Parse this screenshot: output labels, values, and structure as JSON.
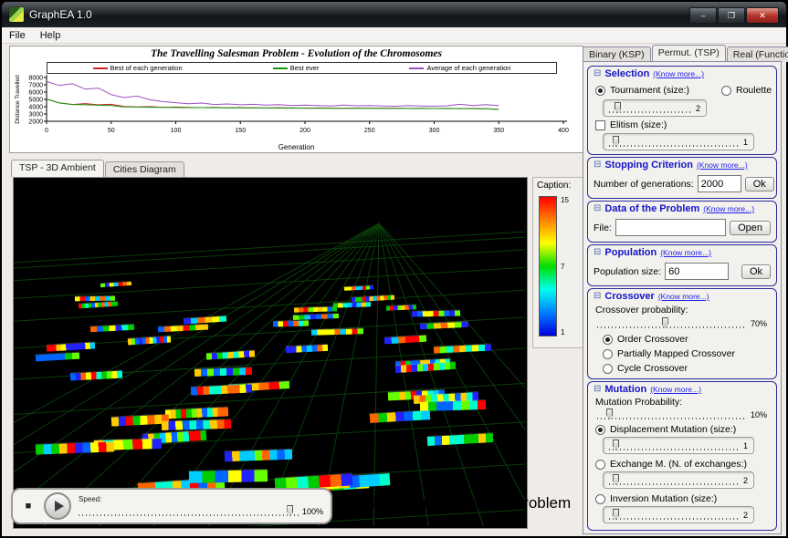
{
  "window": {
    "title": "GraphEA 1.0",
    "menus": [
      "File",
      "Help"
    ]
  },
  "icons": {
    "minimize": "–",
    "maximize": "❐",
    "close": "✕",
    "stop": "■",
    "collapse": "⊟"
  },
  "chart_data": {
    "type": "line",
    "title": "The Travelling Salesman Problem - Evolution of the Chromosomes",
    "xlabel": "Generation",
    "ylabel": "Distance Travelled",
    "xlim": [
      0,
      400
    ],
    "ylim": [
      2000,
      8000
    ],
    "xticks": [
      0,
      50,
      100,
      150,
      200,
      250,
      300,
      350,
      400
    ],
    "yticks": [
      2000,
      3000,
      4000,
      5000,
      6000,
      7000,
      8000
    ],
    "legend_position": "top",
    "grid": false,
    "x": [
      0,
      10,
      20,
      30,
      40,
      50,
      60,
      70,
      80,
      90,
      100,
      110,
      120,
      130,
      140,
      150,
      160,
      170,
      180,
      190,
      200,
      210,
      220,
      230,
      240,
      250,
      260,
      270,
      280,
      290,
      300,
      310,
      320,
      330,
      340,
      350
    ],
    "series": [
      {
        "name": "Best of each generation",
        "color": "#cc2222",
        "y": [
          5050,
          4520,
          4300,
          4420,
          4260,
          4330,
          4020,
          3960,
          4010,
          3900,
          3950,
          3900,
          3880,
          3910,
          3850,
          3880,
          3850,
          3830,
          3860,
          3820,
          3800,
          3830,
          3800,
          3780,
          3810,
          3780,
          3770,
          3790,
          3760,
          3770,
          3750,
          3760,
          3740,
          3750,
          3730,
          3620
        ]
      },
      {
        "name": "Best ever",
        "color": "#119911",
        "y": [
          5050,
          4500,
          4300,
          4260,
          4200,
          4150,
          3980,
          3950,
          3930,
          3900,
          3890,
          3880,
          3870,
          3860,
          3850,
          3840,
          3830,
          3820,
          3810,
          3800,
          3795,
          3790,
          3785,
          3780,
          3775,
          3770,
          3765,
          3760,
          3755,
          3750,
          3745,
          3740,
          3735,
          3730,
          3720,
          3620
        ]
      },
      {
        "name": "Average of each generation",
        "color": "#9b4fc0",
        "y": [
          7450,
          6900,
          7150,
          6400,
          6550,
          5650,
          5250,
          5450,
          4950,
          4700,
          4550,
          4400,
          4500,
          4300,
          4380,
          4260,
          4320,
          4210,
          4280,
          4160,
          4230,
          4150,
          4100,
          4220,
          4120,
          4160,
          4090,
          4060,
          4150,
          4100,
          4060,
          4120,
          4320,
          4160,
          4280,
          4150
        ]
      }
    ]
  },
  "view_tabs": [
    {
      "label": "TSP - 3D Ambient",
      "active": true
    },
    {
      "label": "Cities Diagram",
      "active": false
    }
  ],
  "caption": {
    "title": "Caption:",
    "max": "15",
    "mid": "7",
    "min": "1",
    "colors": [
      "#ff0000",
      "#ff8000",
      "#ffff00",
      "#00dd00",
      "#00ffee",
      "#0080ff",
      "#0000e0"
    ]
  },
  "playback": {
    "speed_label": "Speed:",
    "speed_value": "100%"
  },
  "footer_title": "The Travelling Salesman Problem",
  "right_panel": {
    "tabs": [
      {
        "label": "Binary (KSP)",
        "active": false
      },
      {
        "label": "Permut. (TSP)",
        "active": true
      },
      {
        "label": "Real (Functions)",
        "active": false
      }
    ],
    "know_more": "(Know more...)",
    "selection": {
      "title": "Selection",
      "selected": "tournament",
      "tournament_label": "Tournament (size:)",
      "tournament_size": "2",
      "roulette_label": "Roulette",
      "elitism_label": "Elitism (size:)",
      "elitism_checked": false,
      "elitism_size": "1"
    },
    "stopping": {
      "title": "Stopping Criterion",
      "generations_label": "Number of generations:",
      "generations_value": "2000",
      "ok_label": "Ok"
    },
    "data_problem": {
      "title": "Data of the Problem",
      "file_label": "File:",
      "file_value": "",
      "open_label": "Open"
    },
    "population": {
      "title": "Population",
      "size_label": "Population size:",
      "size_value": "60",
      "ok_label": "Ok"
    },
    "crossover": {
      "title": "Crossover",
      "probability_label": "Crossover probability:",
      "probability_value": "70%",
      "selected": "order",
      "options": [
        "Order Crossover",
        "Partially Mapped Crossover",
        "Cycle Crossover"
      ]
    },
    "mutation": {
      "title": "Mutation",
      "probability_label": "Mutation Probability:",
      "probability_value": "10%",
      "selected": "displacement",
      "displacement_label": "Displacement Mutation (size:)",
      "displacement_size": "1",
      "exchange_label": "Exchange M. (N. of exchanges:)",
      "exchange_size": "2",
      "inversion_label": "Inversion Mutation (size:)",
      "inversion_size": "2"
    }
  }
}
